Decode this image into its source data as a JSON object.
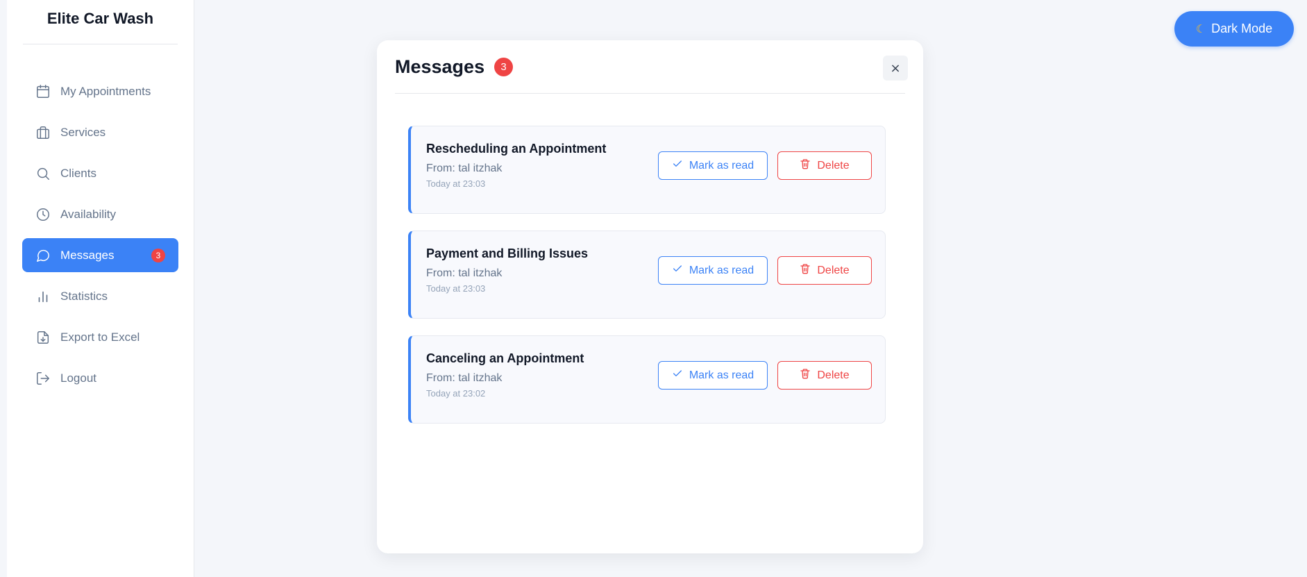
{
  "sidebar": {
    "brand": "Elite Car Wash",
    "items": [
      {
        "label": "My Appointments",
        "icon": "calendar-icon",
        "active": false
      },
      {
        "label": "Services",
        "icon": "briefcase-icon",
        "active": false
      },
      {
        "label": "Clients",
        "icon": "search-icon",
        "active": false
      },
      {
        "label": "Availability",
        "icon": "clock-icon",
        "active": false
      },
      {
        "label": "Messages",
        "icon": "message-icon",
        "active": true,
        "badge": "3"
      },
      {
        "label": "Statistics",
        "icon": "bar-chart-icon",
        "active": false
      },
      {
        "label": "Export to Excel",
        "icon": "file-download-icon",
        "active": false
      },
      {
        "label": "Logout",
        "icon": "logout-icon",
        "active": false
      }
    ]
  },
  "header": {
    "dark_mode_label": "Dark Mode",
    "dark_mode_icon": "moon-icon"
  },
  "modal": {
    "title": "Messages",
    "count": "3",
    "close_label": "×",
    "messages": [
      {
        "subject": "Rescheduling an Appointment",
        "from": "From: tal itzhak",
        "time": "Today at 23:03",
        "read_label": "Mark as read",
        "delete_label": "Delete"
      },
      {
        "subject": "Payment and Billing Issues",
        "from": "From: tal itzhak",
        "time": "Today at 23:03",
        "read_label": "Mark as read",
        "delete_label": "Delete"
      },
      {
        "subject": "Canceling an Appointment",
        "from": "From: tal itzhak",
        "time": "Today at 23:02",
        "read_label": "Mark as read",
        "delete_label": "Delete"
      }
    ]
  },
  "colors": {
    "accent": "#3b82f6",
    "danger": "#ef4444",
    "background": "#f4f6fa"
  }
}
